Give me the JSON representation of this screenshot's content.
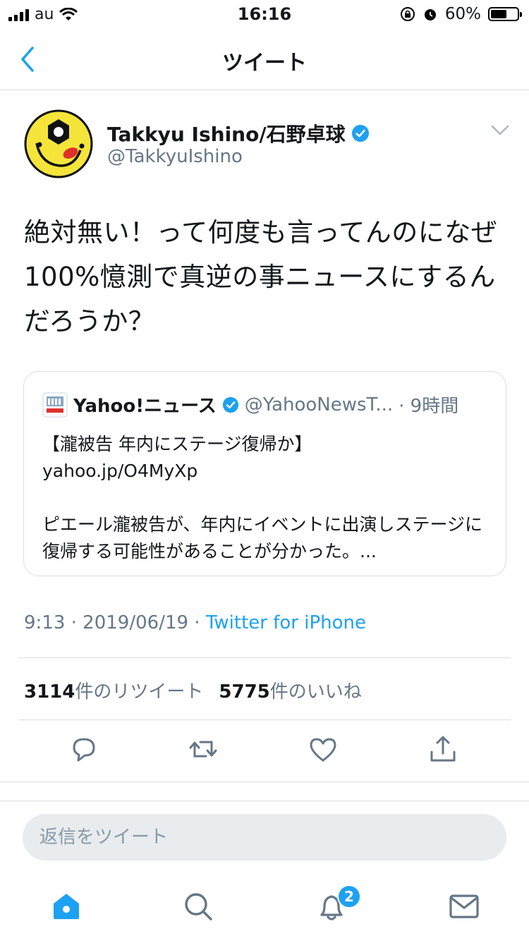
{
  "status_bar": {
    "carrier": "au",
    "time": "16:16",
    "battery": "60%",
    "battery_level": 0.6
  },
  "nav": {
    "title": "ツイート"
  },
  "author": {
    "name": "Takkyu Ishino/石野卓球",
    "handle": "@TakkyuIshino",
    "verified": true
  },
  "tweet": {
    "text": "絶対無い！って何度も言ってんのになぜ100%憶測で真逆の事ニュースにするんだろうか？"
  },
  "quote": {
    "name": "Yahoo!ニュース",
    "handle": "@YahooNewsT...",
    "time": "· 9時間",
    "headline": "【瀧被告 年内にステージ復帰か】",
    "link": "yahoo.jp/O4MyXp",
    "summary": "ピエール瀧被告が、年内にイベントに出演しステージに復帰する可能性があることが分かった。..."
  },
  "meta": {
    "timestamp": "9:13 · 2019/06/19 · ",
    "source": "Twitter for iPhone"
  },
  "stats": {
    "retweets_count": "3114",
    "retweets_label": "件のリツイート",
    "likes_count": "5775",
    "likes_label": "件のいいね"
  },
  "reply": {
    "placeholder": "返信をツイート"
  },
  "tabbar": {
    "notifications_badge": "2"
  },
  "colors": {
    "accent": "#1da1f2",
    "secondary_text": "#657786",
    "divider": "#d9dde0"
  },
  "icons": [
    "back-chevron-icon",
    "verified-badge-icon",
    "chevron-down-icon",
    "reply-icon",
    "retweet-icon",
    "like-icon",
    "share-icon",
    "home-icon",
    "search-icon",
    "notifications-icon",
    "messages-icon"
  ]
}
